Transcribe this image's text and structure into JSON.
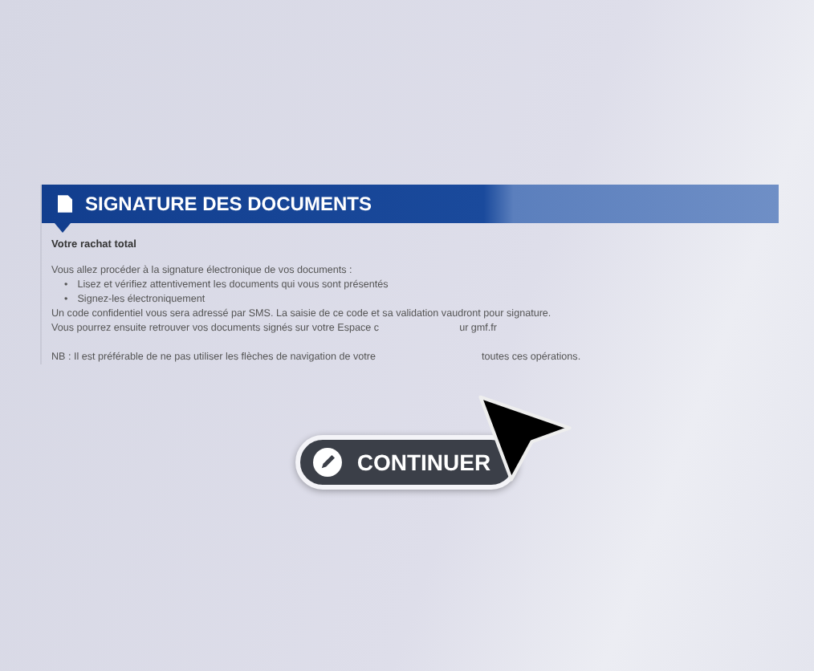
{
  "header": {
    "title": "SIGNATURE DES DOCUMENTS"
  },
  "subtitle": "Votre rachat total",
  "intro": "Vous allez procéder à la signature électronique de vos documents :",
  "bullets": [
    {
      "marker": "•",
      "text": "Lisez et vérifiez attentivement les documents qui vous sont présentés"
    },
    {
      "marker": "•",
      "text": "Signez-les électroniquement"
    }
  ],
  "sms_line": "Un code confidentiel vous sera adressé par SMS. La saisie de ce code et sa validation vaudront pour signature.",
  "espace_line": [
    "Vous pourrez ensuite retrouver vos documents signés sur votre Espace c",
    "ur gmf.fr"
  ],
  "nb_line": [
    "NB : Il est préférable de ne pas utiliser les flèches de navigation de votre",
    "toutes ces opérations."
  ],
  "button": {
    "label": "CONTINUER"
  }
}
